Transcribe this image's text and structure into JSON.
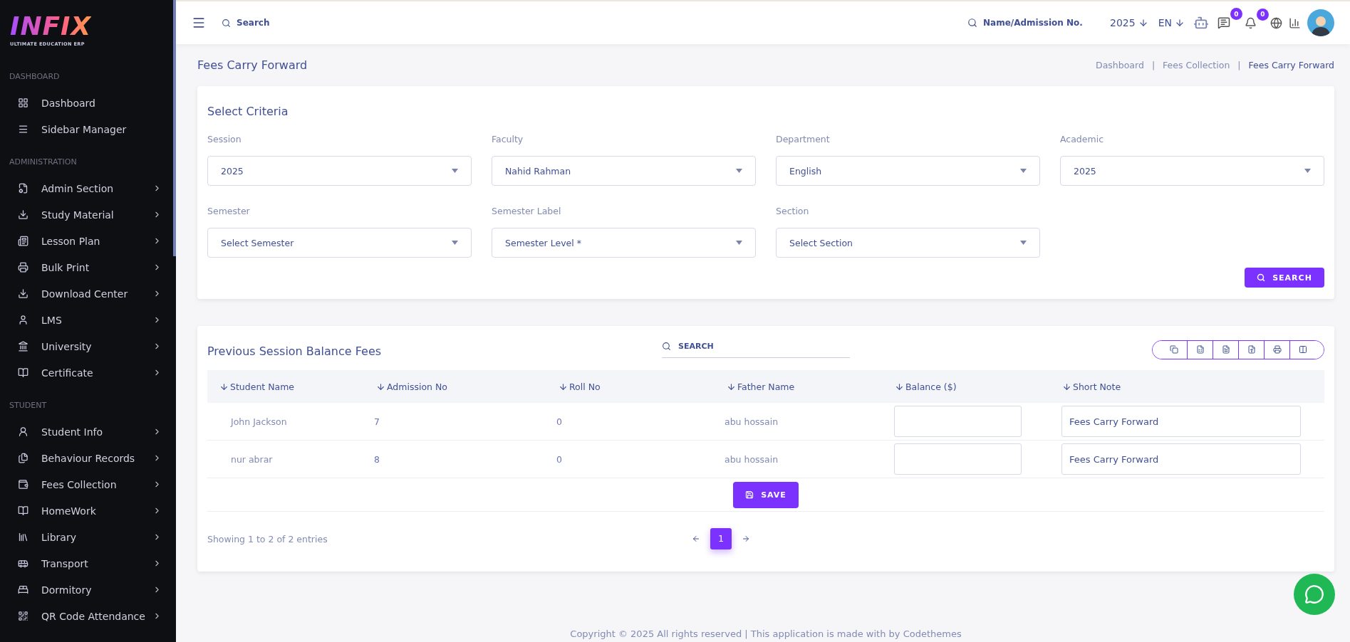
{
  "brand": {
    "name": "INFIX",
    "tagline": "ULTIMATE EDUCATION ERP"
  },
  "sidebar": {
    "sections": [
      {
        "title": "DASHBOARD",
        "items": [
          {
            "label": "Dashboard",
            "has_submenu": false
          },
          {
            "label": "Sidebar Manager",
            "has_submenu": false
          }
        ]
      },
      {
        "title": "ADMINISTRATION",
        "items": [
          {
            "label": "Admin Section",
            "has_submenu": true
          },
          {
            "label": "Study Material",
            "has_submenu": true
          },
          {
            "label": "Lesson Plan",
            "has_submenu": true
          },
          {
            "label": "Bulk Print",
            "has_submenu": true
          },
          {
            "label": "Download Center",
            "has_submenu": true
          },
          {
            "label": "LMS",
            "has_submenu": true
          },
          {
            "label": "University",
            "has_submenu": true
          },
          {
            "label": "Certificate",
            "has_submenu": true
          }
        ]
      },
      {
        "title": "STUDENT",
        "items": [
          {
            "label": "Student Info",
            "has_submenu": true
          },
          {
            "label": "Behaviour Records",
            "has_submenu": true
          },
          {
            "label": "Fees Collection",
            "has_submenu": true
          },
          {
            "label": "HomeWork",
            "has_submenu": true
          },
          {
            "label": "Library",
            "has_submenu": true
          },
          {
            "label": "Transport",
            "has_submenu": true
          },
          {
            "label": "Dormitory",
            "has_submenu": true
          },
          {
            "label": "QR Code Attendance",
            "has_submenu": true
          }
        ]
      }
    ]
  },
  "header": {
    "search": {
      "placeholder": "Search"
    },
    "student_search": {
      "placeholder": "Name/Admission No."
    },
    "year": "2025",
    "language": "EN",
    "messages_count": "0",
    "notifications_count": "0"
  },
  "page": {
    "title": "Fees Carry Forward",
    "breadcrumb_separator": "|",
    "breadcrumbs": [
      {
        "label": "Dashboard",
        "current": false
      },
      {
        "label": "Fees Collection",
        "current": false
      },
      {
        "label": "Fees Carry Forward",
        "current": true
      }
    ]
  },
  "criteria": {
    "title": "Select Criteria",
    "fields": [
      {
        "label": "Session",
        "value": "2025"
      },
      {
        "label": "Faculty",
        "value": "Nahid Rahman"
      },
      {
        "label": "Department",
        "value": "English"
      },
      {
        "label": "Academic",
        "value": "2025"
      },
      {
        "label": "Semester",
        "value": "Select Semester"
      },
      {
        "label": "Semester Label",
        "value": "Semester Level *"
      },
      {
        "label": "Section",
        "value": "Select Section"
      }
    ],
    "search_button": "SEARCH"
  },
  "table": {
    "title": "Previous Session Balance Fees",
    "search": {
      "placeholder": "SEARCH"
    },
    "columns": [
      "Student Name",
      "Admission No",
      "Roll No",
      "Father Name",
      "Balance ($)",
      "Short Note"
    ],
    "rows": [
      {
        "student_name": "John Jackson",
        "admission_no": "7",
        "roll_no": "0",
        "father_name": "abu hossain",
        "short_note": "Fees Carry Forward"
      },
      {
        "student_name": "nur abrar",
        "admission_no": "8",
        "roll_no": "0",
        "father_name": "abu hossain",
        "short_note": "Fees Carry Forward"
      }
    ],
    "save_button": "SAVE",
    "info": "Showing 1 to 2 of 2 entries",
    "pages": [
      {
        "label": "1",
        "selected": true
      }
    ]
  },
  "footer": "Copyright © 2025 All rights reserved | This application is made with by Codethemes"
}
